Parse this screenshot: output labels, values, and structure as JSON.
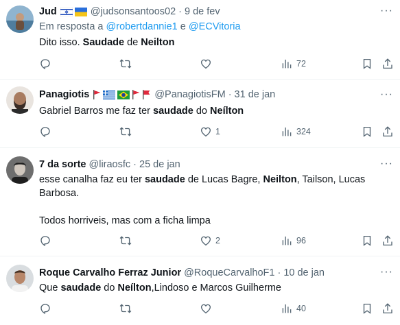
{
  "tweets": [
    {
      "name": "Jud",
      "flags": [
        "israel",
        "ukraine"
      ],
      "handle": "@judsonsantoos02",
      "date": "9 de fev",
      "reply_prefix": "Em resposta a ",
      "reply_user1": "@robertdannie1",
      "reply_joiner": " e ",
      "reply_user2": "@ECVitoria",
      "text_a": "Dito isso. ",
      "text_b": "Saudade",
      "text_c": " de ",
      "text_d": "Neilton",
      "replies": "",
      "retweets": "",
      "likes": "",
      "views": "72"
    },
    {
      "name": "Panagiotis",
      "flags": [
        "red-pennant",
        "greece",
        "brazil",
        "red-pennant",
        "red-flag"
      ],
      "handle": "@PanagiotisFM",
      "date": "31 de jan",
      "text_a": "Gabriel Barros me faz ter ",
      "text_b": "saudade",
      "text_c": " do ",
      "text_d": "Neílton",
      "replies": "",
      "retweets": "",
      "likes": "1",
      "views": "324"
    },
    {
      "name": "7 da sorte",
      "handle": "@liraosfc",
      "date": "25 de jan",
      "text_a": "esse canalha faz eu ter ",
      "text_b": "saudade",
      "text_c": " de Lucas Bagre, ",
      "text_d": "Neilton",
      "text_e": ", Tailson, Lucas Barbosa.",
      "text_f": "Todos horriveis, mas com a ficha limpa",
      "replies": "",
      "retweets": "",
      "likes": "2",
      "views": "96"
    },
    {
      "name": "Roque Carvalho Ferraz Junior",
      "handle": "@RoqueCarvalhoF1",
      "date": "10 de jan",
      "text_a": "Que ",
      "text_b": "saudade",
      "text_c": " do ",
      "text_d": "Neílton",
      "text_e": ",Lindoso e Marcos Guilherme",
      "replies": "",
      "retweets": "",
      "likes": "",
      "views": "40"
    }
  ],
  "separator": "·",
  "menu_glyph": "···",
  "icons": [
    "reply-icon",
    "retweet-icon",
    "like-icon",
    "views-icon",
    "bookmark-icon",
    "share-icon"
  ],
  "colors": {
    "link": "#1d9bf0",
    "muted": "#536471",
    "text": "#0f1419"
  }
}
